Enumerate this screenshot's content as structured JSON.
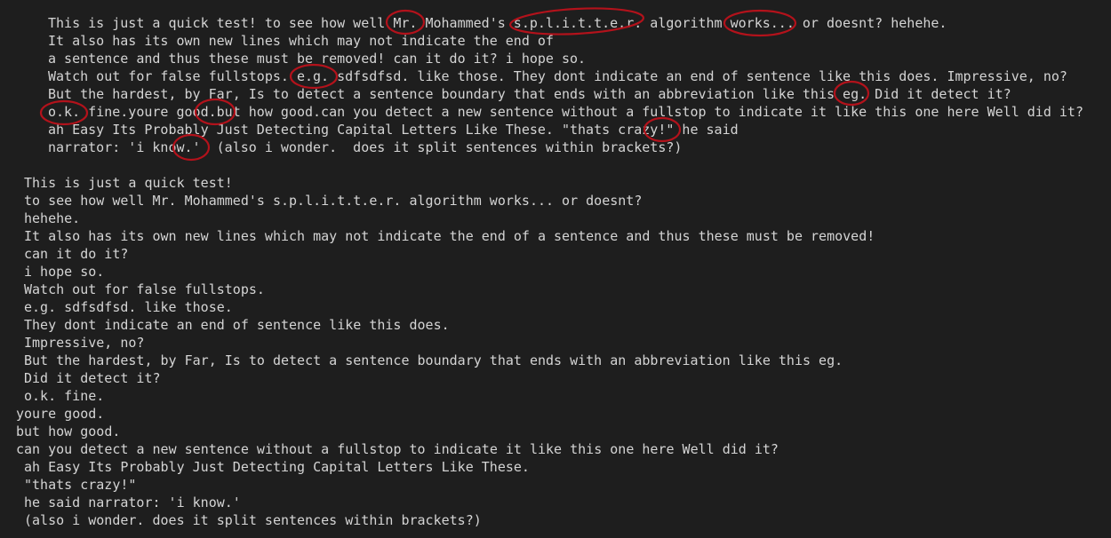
{
  "input_text": {
    "lines": [
      "This is just a quick test! to see how well Mr. Mohammed's s.p.l.i.t.t.e.r. algorithm works... or doesnt? hehehe.",
      "It also has its own new lines which may not indicate the end of",
      "a sentence and thus these must be removed! can it do it? i hope so.",
      "Watch out for false fullstops. e.g. sdfsdfsd. like those. They dont indicate an end of sentence like this does. Impressive, no?",
      "But the hardest, by Far, Is to detect a sentence boundary that ends with an abbreviation like this eg. Did it detect it?",
      "o.k. fine.youre good.but how good.can you detect a new sentence without a fullstop to indicate it like this one here Well did it?",
      "ah Easy Its Probably Just Detecting Capital Letters Like These. \"thats crazy!\" he said",
      "narrator: 'i know.'  (also i wonder.  does it split sentences within brackets?)"
    ]
  },
  "output_sentences": [
    "This is just a quick test!",
    "to see how well Mr. Mohammed's s.p.l.i.t.t.e.r. algorithm works... or doesnt?",
    "hehehe.",
    "It also has its own new lines which may not indicate the end of a sentence and thus these must be removed!",
    "can it do it?",
    "i hope so.",
    "Watch out for false fullstops.",
    "e.g. sdfsdfsd. like those.",
    "They dont indicate an end of sentence like this does.",
    "Impressive, no?",
    "But the hardest, by Far, Is to detect a sentence boundary that ends with an abbreviation like this eg.",
    "Did it detect it?",
    "o.k. fine.",
    "youre good.",
    "but how good.",
    "can you detect a new sentence without a fullstop to indicate it like this one here Well did it?",
    "ah Easy Its Probably Just Detecting Capital Letters Like These.",
    "\"thats crazy!\"",
    "he said narrator: 'i know.'",
    "(also i wonder. does it split sentences within brackets?)"
  ],
  "colors": {
    "background": "#1e1e1e",
    "text": "#d4d4d4",
    "annotation": "#b3121b"
  }
}
